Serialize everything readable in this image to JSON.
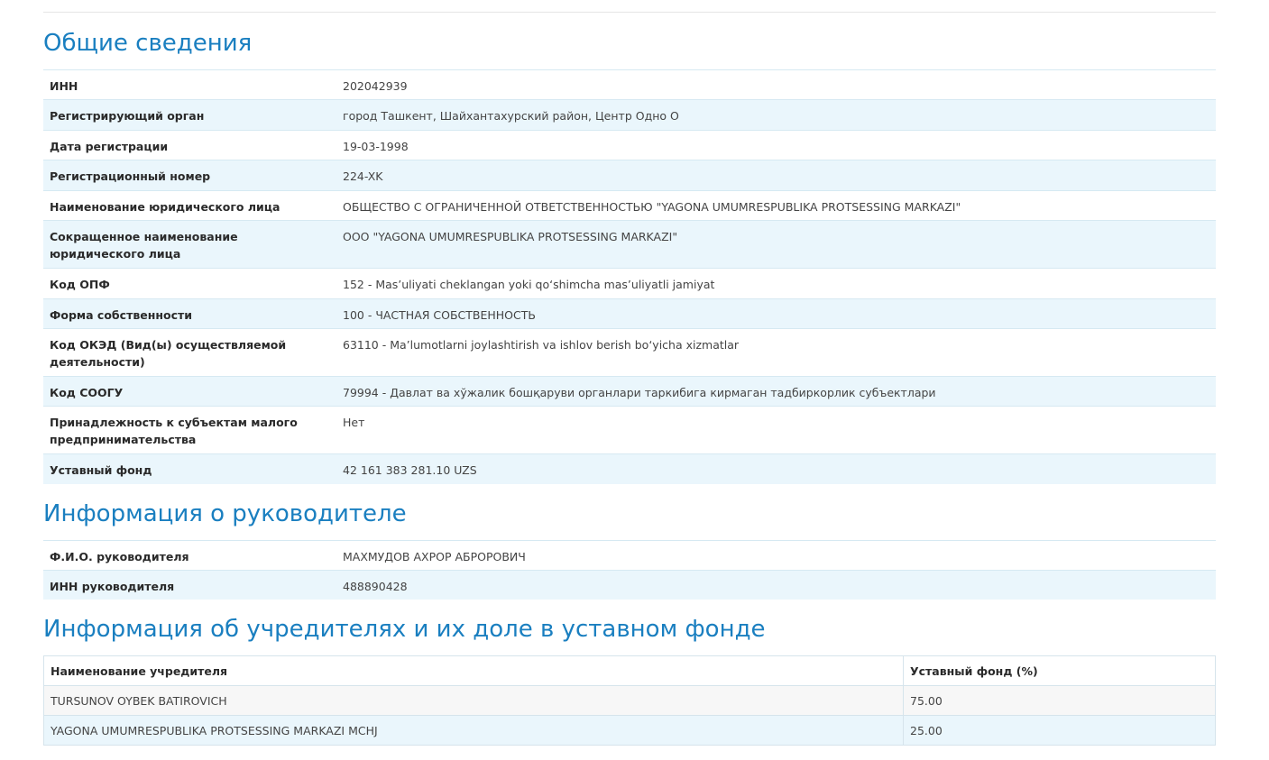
{
  "general": {
    "title": "Общие сведения",
    "rows": [
      {
        "label": "ИНН",
        "value": "202042939"
      },
      {
        "label": "Регистрирующий орган",
        "value": "город Ташкент, Шайхантахурский район, Центр Одно О"
      },
      {
        "label": "Дата регистрации",
        "value": "19-03-1998"
      },
      {
        "label": "Регистрационный номер",
        "value": "224-XK"
      },
      {
        "label": "Наименование юридического лица",
        "value": "ОБЩЕСТВО С ОГРАНИЧЕННОЙ ОТВЕТСТВЕННОСТЬЮ \"YAGONA UMUMRESPUBLIKA PROTSESSING MARKAZI\""
      },
      {
        "label": "Сокращенное наименование юридического лица",
        "value": "ООО \"YAGONA UMUMRESPUBLIKA PROTSESSING MARKAZI\""
      },
      {
        "label": "Код ОПФ",
        "value": "152 - Mas’uliyati cheklangan yoki qo‘shimcha mas’uliyatli jamiyat"
      },
      {
        "label": "Форма собственности",
        "value": "100 - ЧАСТНАЯ СОБСТВЕННОСТЬ"
      },
      {
        "label": "Код ОКЭД (Вид(ы) осуществляемой деятельности)",
        "value": "63110 - Ma’lumotlarni joylashtirish va ishlov berish bo‘yicha xizmatlar"
      },
      {
        "label": "Код СООГУ",
        "value": "79994 - Давлат ва хўжалик бошқаруви органлари таркибига кирмаган тадбиркорлик субъектлари"
      },
      {
        "label": "Принадлежность к субъектам малого предпринимательства",
        "value": "Нет"
      },
      {
        "label": "Уставный фонд",
        "value": "42 161 383 281.10 UZS"
      }
    ]
  },
  "director": {
    "title": "Информация о руководителе",
    "rows": [
      {
        "label": "Ф.И.О. руководителя",
        "value": "МАХМУДОВ АХРОР АБРОРОВИЧ"
      },
      {
        "label": "ИНН руководителя",
        "value": "488890428"
      }
    ]
  },
  "founders": {
    "title": "Информация об учредителях и их доле в уставном фонде",
    "headers": {
      "name": "Наименование учредителя",
      "share": "Уставный фонд (%)"
    },
    "rows": [
      {
        "name": "TURSUNOV OYBEK BATIROVICH",
        "share": "75.00"
      },
      {
        "name": "YAGONA UMUMRESPUBLIKA PROTSESSING MARKAZI MCHJ",
        "share": "25.00"
      }
    ]
  }
}
